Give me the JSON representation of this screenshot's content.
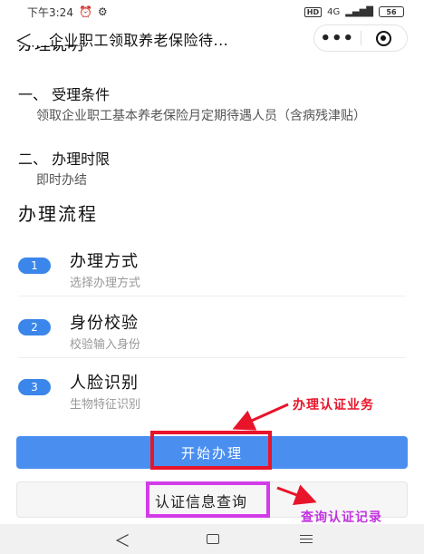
{
  "status_bar": {
    "time": "下午3:24",
    "alarm_icon": "alarm-icon",
    "signal_icon": "signal-icon",
    "hd": "HD",
    "network": "4G",
    "battery": "56"
  },
  "nav": {
    "title": "企业职工领取养老保险待...",
    "back_glyph": "＜",
    "more_glyph": "•••"
  },
  "partial_heading": "办理说明",
  "sections": [
    {
      "title": "一、 受理条件",
      "body": "领取企业职工基本养老保险月定期待遇人员（含病残津贴）"
    },
    {
      "title": "二、 办理时限",
      "body": "即时办结"
    }
  ],
  "process_title": "办理流程",
  "steps": [
    {
      "num": "1",
      "title": "办理方式",
      "desc": "选择办理方式"
    },
    {
      "num": "2",
      "title": "身份校验",
      "desc": "校验输入身份"
    },
    {
      "num": "3",
      "title": "人脸识别",
      "desc": "生物特征识别"
    }
  ],
  "buttons": {
    "start": "开始办理",
    "query": "认证信息查询"
  },
  "annotations": {
    "start_note": "办理认证业务",
    "query_note": "查询认证记录",
    "start_color": "#e8142a",
    "query_color": "#d23ce8"
  },
  "colors": {
    "accent": "#4a8ff0",
    "step_badge": "#3b86ea"
  },
  "bottom_nav": {
    "back_glyph": "＜"
  }
}
